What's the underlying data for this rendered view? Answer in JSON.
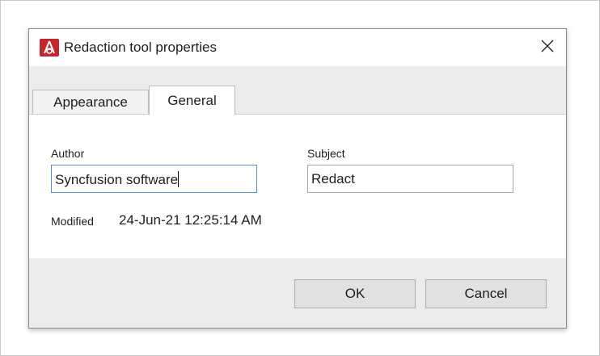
{
  "dialog": {
    "title": "Redaction tool properties",
    "tabs": [
      {
        "label": "Appearance",
        "selected": false
      },
      {
        "label": "General",
        "selected": true
      }
    ],
    "author": {
      "label": "Author",
      "value": "Syncfusion software",
      "focused": true
    },
    "subject": {
      "label": "Subject",
      "value": "Redact"
    },
    "modified": {
      "label": "Modified",
      "value": "24-Jun-21 12:25:14 AM"
    },
    "buttons": {
      "ok": "OK",
      "cancel": "Cancel"
    },
    "icons": {
      "app": "redaction-app-icon",
      "close": "close-icon"
    },
    "colors": {
      "accent_icon": "#c1272d",
      "focus_border": "#4f8fd3",
      "chrome": "#ececec"
    }
  }
}
